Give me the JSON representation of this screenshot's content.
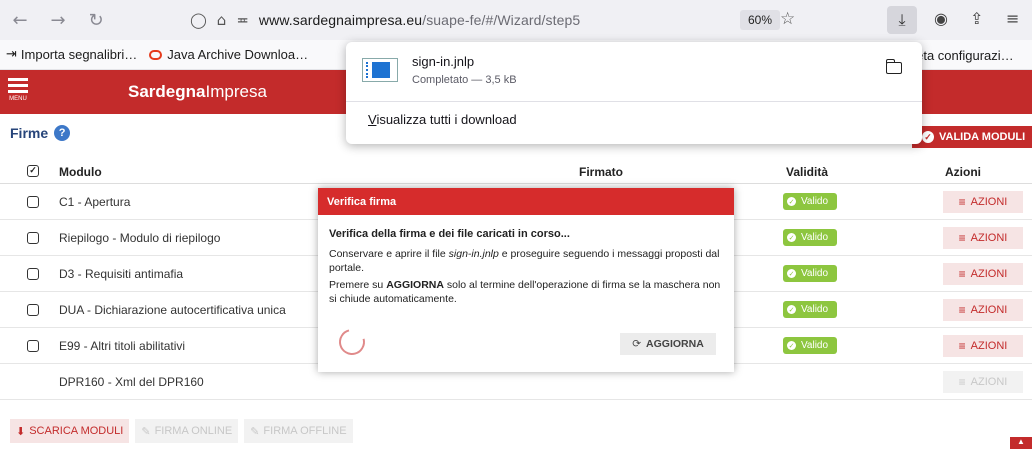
{
  "browser": {
    "url_host": "www.sardegnaimpresa.eu",
    "url_path": "/suape-fe/#/Wizard/step5",
    "zoom": "60%",
    "icons": [
      "back-arrow-icon",
      "forward-arrow-icon",
      "reload-icon",
      "shield-icon",
      "lock-icon",
      "permissions-icon",
      "star-icon",
      "download-icon",
      "extension-icon",
      "share-icon",
      "menu-icon"
    ]
  },
  "bookmarks": {
    "items": [
      {
        "label": "Importa segnalibri…",
        "icon": "import-icon"
      },
      {
        "label": "Java Archive Downloa…",
        "icon": "oracle-ring-icon"
      }
    ],
    "right_label": "pleta configurazi…"
  },
  "app": {
    "menu_label": "MENU",
    "brand_bold": "Sardegna",
    "brand_light": "Impresa",
    "accent_color": "#c32b2b"
  },
  "section": {
    "title": "Firme",
    "valida_label": "VALIDA MODULI"
  },
  "table": {
    "headers": {
      "modulo": "Modulo",
      "firmato": "Firmato",
      "validita": "Validità",
      "azioni": "Azioni"
    },
    "rows": [
      {
        "modulo": "C1 - Apertura",
        "validita": "Valido",
        "azioni": "AZIONI"
      },
      {
        "modulo": "Riepilogo - Modulo di riepilogo",
        "validita": "Valido",
        "azioni": "AZIONI"
      },
      {
        "modulo": "D3 - Requisiti antimafia",
        "validita": "Valido",
        "azioni": "AZIONI"
      },
      {
        "modulo": "DUA - Dichiarazione autocertificativa unica",
        "validita": "Valido",
        "azioni": "AZIONI"
      },
      {
        "modulo": "E99 - Altri titoli abilitativi",
        "validita": "Valido",
        "azioni": "AZIONI"
      },
      {
        "modulo": "DPR160 - Xml del DPR160",
        "validita": "",
        "azioni": "AZIONI"
      }
    ]
  },
  "footer": {
    "scarica": "SCARICA MODULI",
    "firma_online": "FIRMA ONLINE",
    "firma_offline": "FIRMA OFFLINE"
  },
  "modal": {
    "title": "Verifica firma",
    "lead": "Verifica della firma e dei file caricati in corso...",
    "p1_before": "Conservare e aprire il file ",
    "p1_file": "sign-in.jnlp",
    "p1_after": " e proseguire seguendo i messaggi proposti dal portale.",
    "p2_before": "Premere su ",
    "p2_bold": "AGGIORNA",
    "p2_after": " solo al termine dell'operazione di firma se la maschera non si chiude automaticamente.",
    "button": "AGGIORNA"
  },
  "downloads": {
    "file_name": "sign-in.jnlp",
    "status": "Completato — 3,5 kB",
    "show_all_first": "V",
    "show_all_rest": "isualizza tutti i download"
  }
}
